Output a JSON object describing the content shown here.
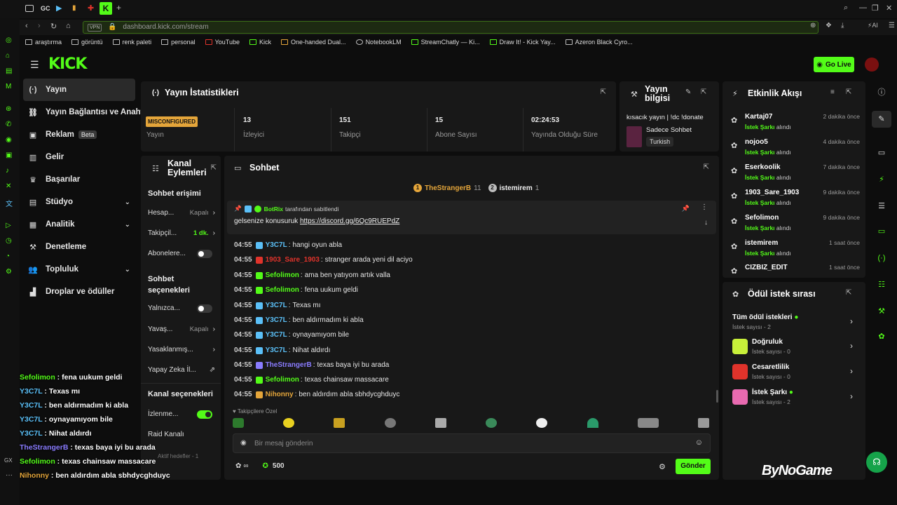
{
  "browser": {
    "tab_labels": [
      "GC"
    ],
    "url": "dashboard.kick.com/stream",
    "vpn_label": "VPN",
    "bookmarks": [
      "araştırma",
      "görüntü",
      "renk paleti",
      "personal",
      "YouTube",
      "Kick",
      "One-handed Dual...",
      "NotebookLM",
      "StreamChatly — Ki...",
      "Draw It! - Kick Yay...",
      "Azeron Black Cyro..."
    ]
  },
  "header": {
    "logo": "KICK",
    "go_live": "Go Live"
  },
  "nav": [
    {
      "label": "Yayın",
      "icon": "broadcast-icon",
      "active": true
    },
    {
      "label": "Yayın Bağlantısı ve Anahtar",
      "icon": "link-icon"
    },
    {
      "label": "Reklam",
      "icon": "ad-icon",
      "badge": "Beta"
    },
    {
      "label": "Gelir",
      "icon": "revenue-icon"
    },
    {
      "label": "Başarılar",
      "icon": "trophy-icon"
    },
    {
      "label": "Stüdyo",
      "icon": "studio-icon",
      "chevron": true
    },
    {
      "label": "Analitik",
      "icon": "analytics-icon",
      "chevron": true
    },
    {
      "label": "Denetleme",
      "icon": "moderation-icon"
    },
    {
      "label": "Topluluk",
      "icon": "community-icon",
      "chevron": true
    },
    {
      "label": "Droplar ve ödüller",
      "icon": "drops-icon"
    }
  ],
  "stats": {
    "title": "Yayın İstatistikleri",
    "status_badge": "MISCONFIGURED",
    "status_label": "Yayın",
    "items": [
      {
        "value": "13",
        "label": "İzleyici"
      },
      {
        "value": "151",
        "label": "Takipçi"
      },
      {
        "value": "15",
        "label": "Abone Sayısı"
      },
      {
        "value": "02:24:53",
        "label": "Yayında Olduğu Süre"
      }
    ]
  },
  "stream_info": {
    "title": "Yayın bilgisi",
    "stream_title": "kısacık yayın | !dc !donate",
    "category": "Sadece Sohbet",
    "language": "Turkish"
  },
  "activity": {
    "title": "Etkinlik Akışı",
    "event_label": "İstek Şarkı",
    "event_suffix": "alındı",
    "items": [
      {
        "user": "Kartaj07",
        "time": "2 dakika önce"
      },
      {
        "user": "nojoo5",
        "time": "4 dakika önce"
      },
      {
        "user": "Eserkoolik",
        "time": "7 dakika önce"
      },
      {
        "user": "1903_Sare_1903",
        "time": "9 dakika önce"
      },
      {
        "user": "Sefolimon",
        "time": "9 dakika önce"
      },
      {
        "user": "istemirem",
        "time": "1 saat önce"
      },
      {
        "user": "CIZBIZ_EDIT",
        "time": "1 saat önce"
      }
    ]
  },
  "rewards": {
    "title": "Ödül istek sırası",
    "all_label": "Tüm ödül istekleri",
    "all_count": "İstek sayısı - 2",
    "items": [
      {
        "name": "Doğruluk",
        "count": "İstek sayısı - 0",
        "color": "#c8f03a"
      },
      {
        "name": "Cesaretlilik",
        "count": "İstek sayısı - 0",
        "color": "#e0332b"
      },
      {
        "name": "İstek Şarkı",
        "count": "İstek sayısı - 2",
        "color": "#e86ab0"
      }
    ]
  },
  "channel_actions": {
    "title": "Kanal Eylemleri",
    "chat_access": "Sohbet erişimi",
    "rows1": [
      {
        "label": "Hesap...",
        "value": "Kapalı"
      },
      {
        "label": "Takipçil...",
        "value": "1 dk."
      },
      {
        "label": "Abonelere..."
      }
    ],
    "chat_options": "Sohbet seçenekleri",
    "rows2": [
      {
        "label": "Yalnızca..."
      },
      {
        "label": "Yavaş...",
        "value": "Kapalı"
      },
      {
        "label": "Yasaklanmış..."
      },
      {
        "label": "Yapay Zeka İl..."
      }
    ],
    "channel_options": "Kanal seçenekleri",
    "rows3": [
      {
        "label": "İzlenme..."
      },
      {
        "label": "Raid Kanalı"
      }
    ],
    "active_goals": "Aktif hedefler - 1"
  },
  "chat": {
    "title": "Sohbet",
    "top_users": [
      {
        "rank": "1",
        "name": "TheStrangerB",
        "count": "11"
      },
      {
        "rank": "2",
        "name": "istemirem",
        "count": "1"
      }
    ],
    "pinned_by": "BotRix",
    "pinned_suffix": "tarafından sabitlendi",
    "pinned_text": "gelsenize konusuruk",
    "pinned_link": "https://discord.gg/6Qc9RUEPdZ",
    "messages": [
      {
        "time": "04:55",
        "user": "Y3C7L",
        "color": "#5bc0f8",
        "text": "hangi oyun abla"
      },
      {
        "time": "04:55",
        "user": "1903_Sare_1903",
        "color": "#e0332b",
        "text": "stranger arada yeni dil aciyo"
      },
      {
        "time": "04:55",
        "user": "Sefolimon",
        "color": "#53fc18",
        "text": "ama ben yatıyom artık valla"
      },
      {
        "time": "04:55",
        "user": "Sefolimon",
        "color": "#53fc18",
        "text": "fena uukum geldi"
      },
      {
        "time": "04:55",
        "user": "Y3C7L",
        "color": "#5bc0f8",
        "text": "Texas mı"
      },
      {
        "time": "04:55",
        "user": "Y3C7L",
        "color": "#5bc0f8",
        "text": "ben aldırmadım ki abla"
      },
      {
        "time": "04:55",
        "user": "Y3C7L",
        "color": "#5bc0f8",
        "text": "oynayamıyom bile"
      },
      {
        "time": "04:55",
        "user": "Y3C7L",
        "color": "#5bc0f8",
        "text": "Nihat aldırdı"
      },
      {
        "time": "04:55",
        "user": "TheStrangerB",
        "color": "#8a7cff",
        "text": "texas baya iyi bu arada"
      },
      {
        "time": "04:55",
        "user": "Sefolimon",
        "color": "#53fc18",
        "text": "texas chainsaw massacare"
      },
      {
        "time": "04:55",
        "user": "Nihonny",
        "color": "#e4a53a",
        "text": "ben aldırdım abla sbhdycghduyc"
      }
    ],
    "emote_section": "Takipçilere Özel",
    "input_placeholder": "Bir mesaj gönderin",
    "points": "500",
    "send": "Gönder"
  },
  "overlay": {
    "messages": [
      {
        "user": "Sefolimon",
        "color": "#53fc18",
        "text": "fena uukum geldi"
      },
      {
        "user": "Y3C7L",
        "color": "#5bc0f8",
        "text": "Texas mı"
      },
      {
        "user": "Y3C7L",
        "color": "#5bc0f8",
        "text": "ben aldırmadım ki abla"
      },
      {
        "user": "Y3C7L",
        "color": "#5bc0f8",
        "text": "oynayamıyom bile"
      },
      {
        "user": "Y3C7L",
        "color": "#5bc0f8",
        "text": "Nihat aldırdı"
      },
      {
        "user": "TheStrangerB",
        "color": "#8a7cff",
        "text": "texas baya iyi bu arada"
      },
      {
        "user": "Sefolimon",
        "color": "#53fc18",
        "text": "texas chainsaw massacare"
      },
      {
        "user": "Nihonny",
        "color": "#e4a53a",
        "text": "ben aldırdım abla sbhdycghduyc"
      }
    ],
    "watermark": "ByNoGame"
  }
}
